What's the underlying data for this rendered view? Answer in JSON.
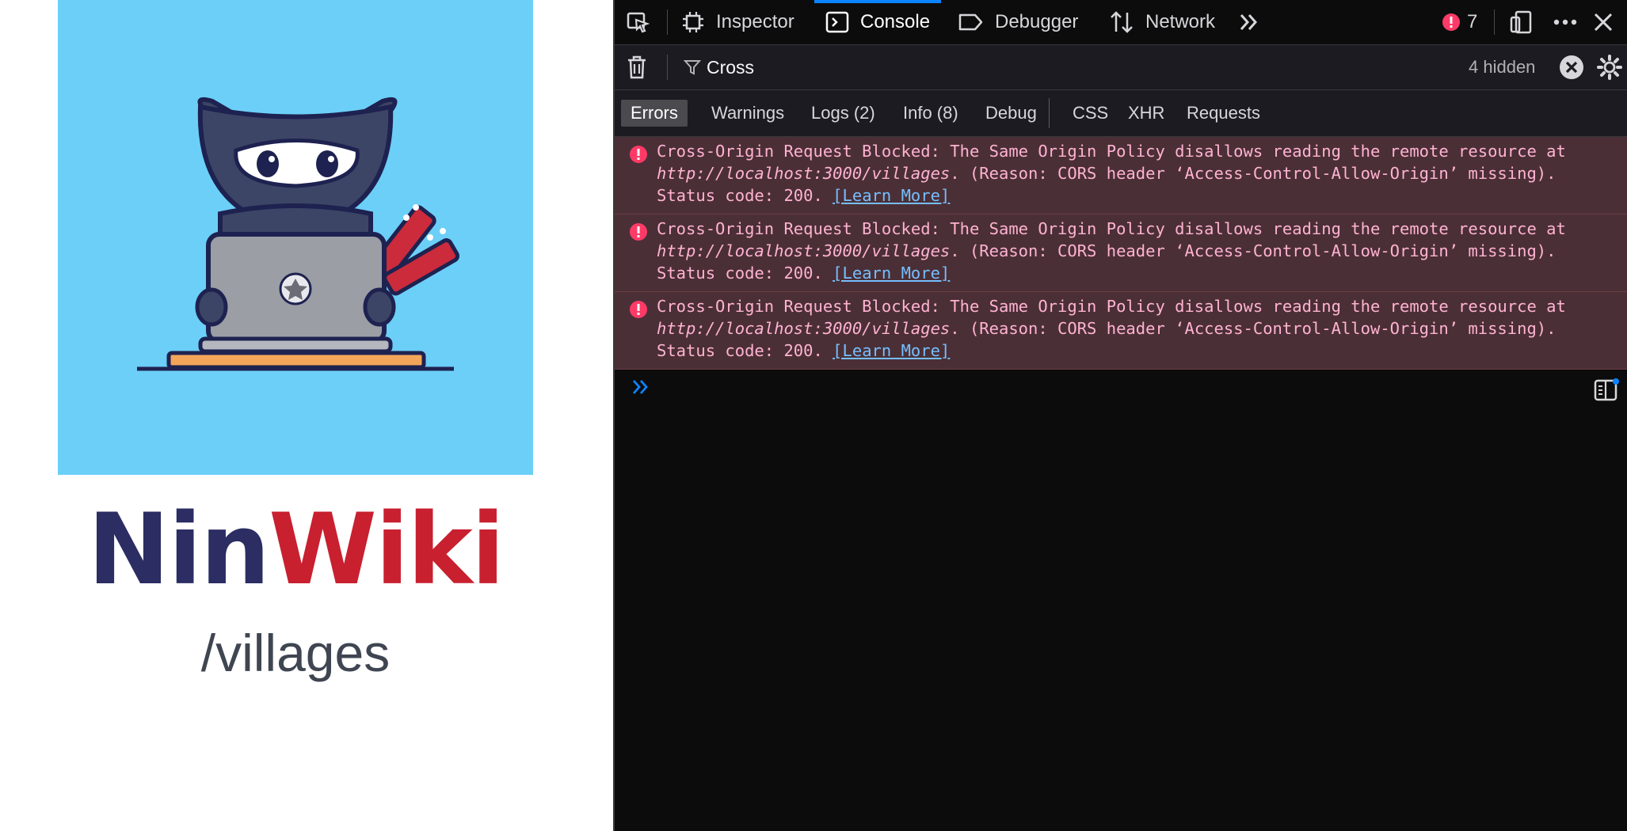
{
  "page": {
    "brand_part1": "Nin",
    "brand_part2": "Wiki",
    "route": "/villages"
  },
  "devtools": {
    "tabs": [
      {
        "label": "Inspector",
        "icon": "inspector-icon"
      },
      {
        "label": "Console",
        "icon": "console-icon",
        "selected": true
      },
      {
        "label": "Debugger",
        "icon": "debugger-icon"
      },
      {
        "label": "Network",
        "icon": "network-icon"
      }
    ],
    "error_count": "7",
    "filter": {
      "value": "Cross",
      "hidden_count": "4 hidden"
    },
    "levels": [
      {
        "label": "Errors",
        "active": true
      },
      {
        "label": "Warnings"
      },
      {
        "label": "Logs (2)"
      },
      {
        "label": "Info (8)"
      },
      {
        "label": "Debug"
      }
    ],
    "request_filters": [
      "CSS",
      "XHR",
      "Requests"
    ],
    "messages": [
      {
        "prefix": "Cross-Origin Request Blocked: The Same Origin Policy disallows reading the remote resource at ",
        "url": "http://localhost:3000/villages",
        "suffix": ". (Reason: CORS header ‘Access-Control-Allow-Origin’ missing). Status code: 200. ",
        "link": "[Learn More]"
      },
      {
        "prefix": "Cross-Origin Request Blocked: The Same Origin Policy disallows reading the remote resource at ",
        "url": "http://localhost:3000/villages",
        "suffix": ". (Reason: CORS header ‘Access-Control-Allow-Origin’ missing). Status code: 200. ",
        "link": "[Learn More]"
      },
      {
        "prefix": "Cross-Origin Request Blocked: The Same Origin Policy disallows reading the remote resource at ",
        "url": "http://localhost:3000/villages",
        "suffix": ". (Reason: CORS header ‘Access-Control-Allow-Origin’ missing). Status code: 200. ",
        "link": "[Learn More]"
      }
    ],
    "colors": {
      "accent": "#0a84ff",
      "error_bg": "#4b2f36",
      "error_text": "#ffb3d2",
      "link": "#75bfff",
      "error_badge": "#ff3a67"
    }
  }
}
